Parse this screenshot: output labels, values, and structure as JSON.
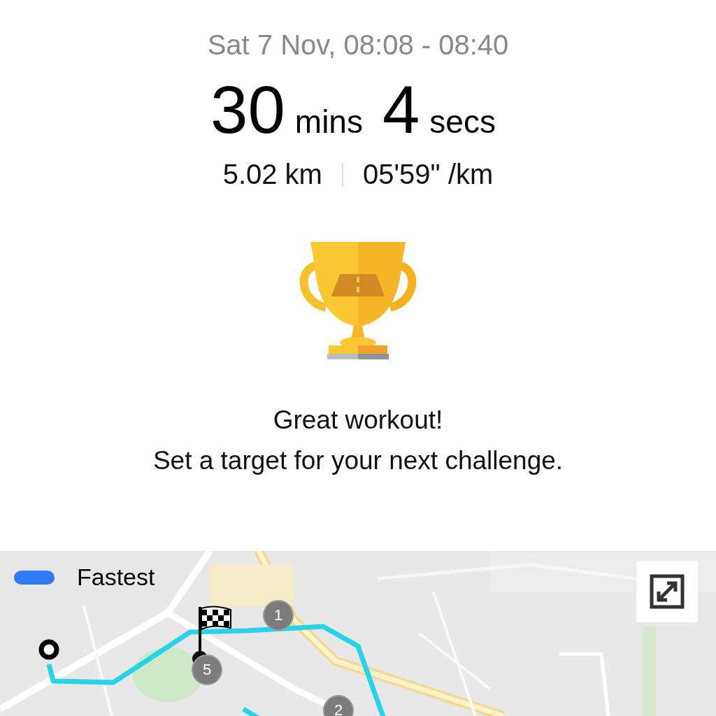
{
  "workout": {
    "date": "Sat 7 Nov, 08:08 - 08:40",
    "duration": [
      {
        "value": "30",
        "unit": "mins"
      },
      {
        "value": "4",
        "unit": "secs"
      }
    ],
    "distance": "5.02 km",
    "pace": "05'59\" /km"
  },
  "message": {
    "title": "Great workout!",
    "subtitle": "Set a target for your next challenge."
  },
  "map": {
    "legend": {
      "label": "Fastest",
      "color": "#2f7cf6"
    },
    "km_markers": [
      "1",
      "5",
      "2"
    ]
  }
}
